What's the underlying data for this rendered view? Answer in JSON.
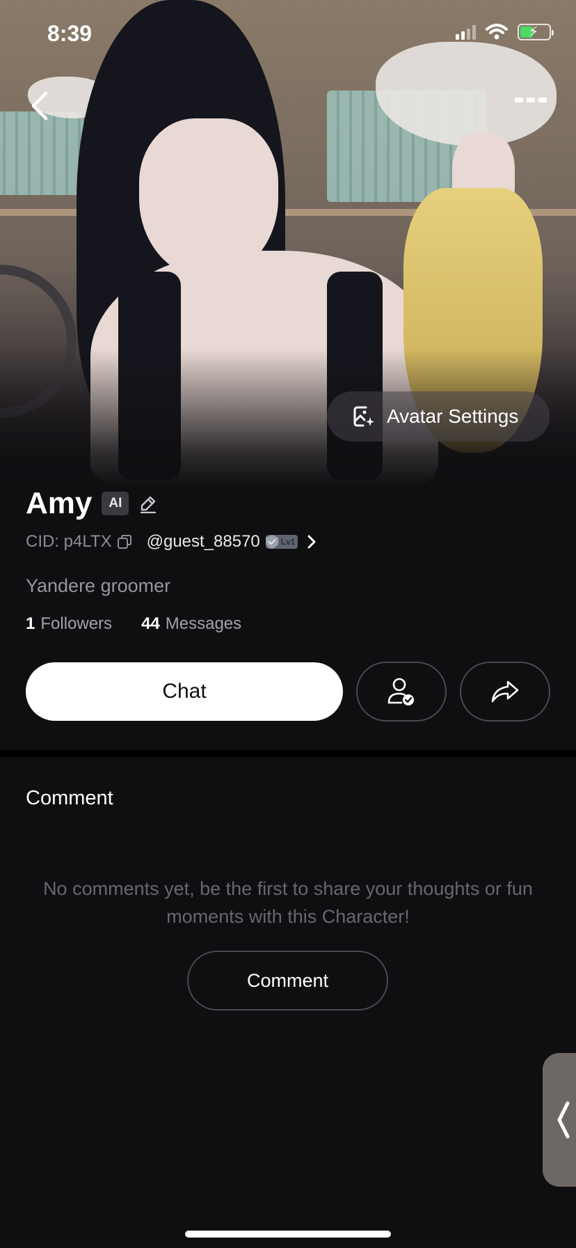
{
  "status_bar": {
    "time": "8:39"
  },
  "hero": {
    "avatar_settings_label": "Avatar Settings"
  },
  "profile": {
    "name": "Amy",
    "ai_badge": "AI",
    "cid": "CID: p4LTX",
    "handle": "@guest_88570",
    "level_badge": "Lv1",
    "bio": "Yandere groomer",
    "followers_count": "1",
    "followers_label": "Followers",
    "messages_count": "44",
    "messages_label": "Messages"
  },
  "actions": {
    "chat_label": "Chat"
  },
  "comments": {
    "title": "Comment",
    "empty_text": "No comments yet, be the first to share your thoughts or fun moments with this Character!",
    "button_label": "Comment"
  },
  "colors": {
    "battery": "#4cd964",
    "background": "#0f0e11",
    "primary_button": "#ffffff"
  }
}
